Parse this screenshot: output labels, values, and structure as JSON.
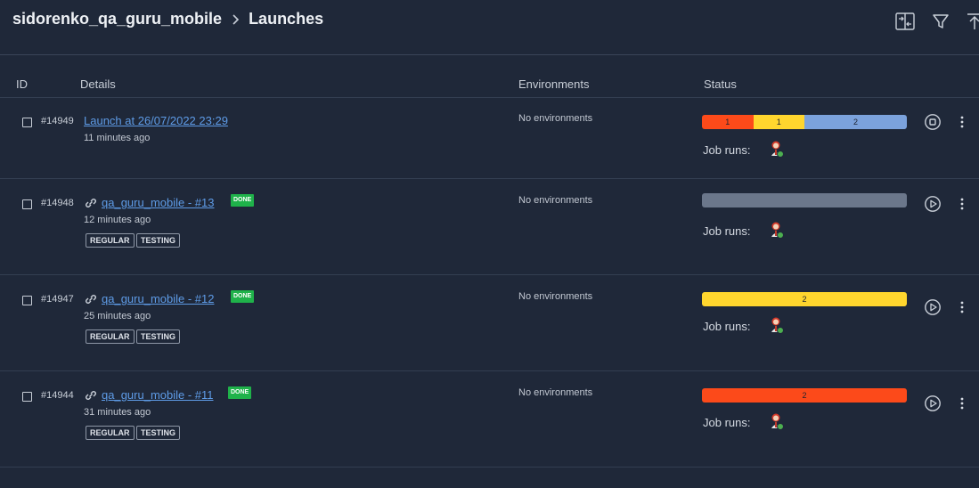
{
  "breadcrumb": {
    "project": "sidorenko_qa_guru_mobile",
    "page": "Launches"
  },
  "toolbar": {
    "icons": [
      "compare-icon",
      "filter-icon",
      "upload-icon"
    ]
  },
  "columns": {
    "id": "ID",
    "details": "Details",
    "environments": "Environments",
    "status": "Status"
  },
  "colors": {
    "background": "#1f2839",
    "link": "#5e9be6",
    "done_badge": "#1fb24a",
    "failed": "#fc4a1a",
    "broken": "#ffd62e",
    "passed_blue": "#7ba2dc",
    "unknown": "#6b778b"
  },
  "launches": [
    {
      "id": "#14949",
      "name": "Launch at 26/07/2022 23:29",
      "has_link_icon": false,
      "badge": "",
      "time_ago": "11 minutes ago",
      "tags": [],
      "environments": "No environments",
      "status_segments": [
        {
          "label": "1",
          "count": 1,
          "color": "#fc4a1a"
        },
        {
          "label": "1",
          "count": 1,
          "color": "#ffd62e"
        },
        {
          "label": "2",
          "count": 2,
          "color": "#7ba2dc"
        }
      ],
      "job_runs_label": "Job runs:",
      "action": "stop-icon"
    },
    {
      "id": "#14948",
      "name": "qa_guru_mobile - #13",
      "has_link_icon": true,
      "badge": "DONE",
      "time_ago": "12 minutes ago",
      "tags": [
        "REGULAR",
        "TESTING"
      ],
      "environments": "No environments",
      "status_segments": [
        {
          "label": "",
          "count": 1,
          "color": "#6b778b"
        }
      ],
      "job_runs_label": "Job runs:",
      "action": "play-icon"
    },
    {
      "id": "#14947",
      "name": "qa_guru_mobile - #12",
      "has_link_icon": true,
      "badge": "DONE",
      "time_ago": "25 minutes ago",
      "tags": [
        "REGULAR",
        "TESTING"
      ],
      "environments": "No environments",
      "status_segments": [
        {
          "label": "2",
          "count": 2,
          "color": "#ffd62e"
        }
      ],
      "job_runs_label": "Job runs:",
      "action": "play-icon"
    },
    {
      "id": "#14944",
      "name": "qa_guru_mobile - #11",
      "has_link_icon": true,
      "badge": "DONE",
      "time_ago": "31 minutes ago",
      "tags": [
        "REGULAR",
        "TESTING"
      ],
      "environments": "No environments",
      "status_segments": [
        {
          "label": "2",
          "count": 2,
          "color": "#fc4a1a"
        }
      ],
      "job_runs_label": "Job runs:",
      "action": "play-icon"
    }
  ]
}
